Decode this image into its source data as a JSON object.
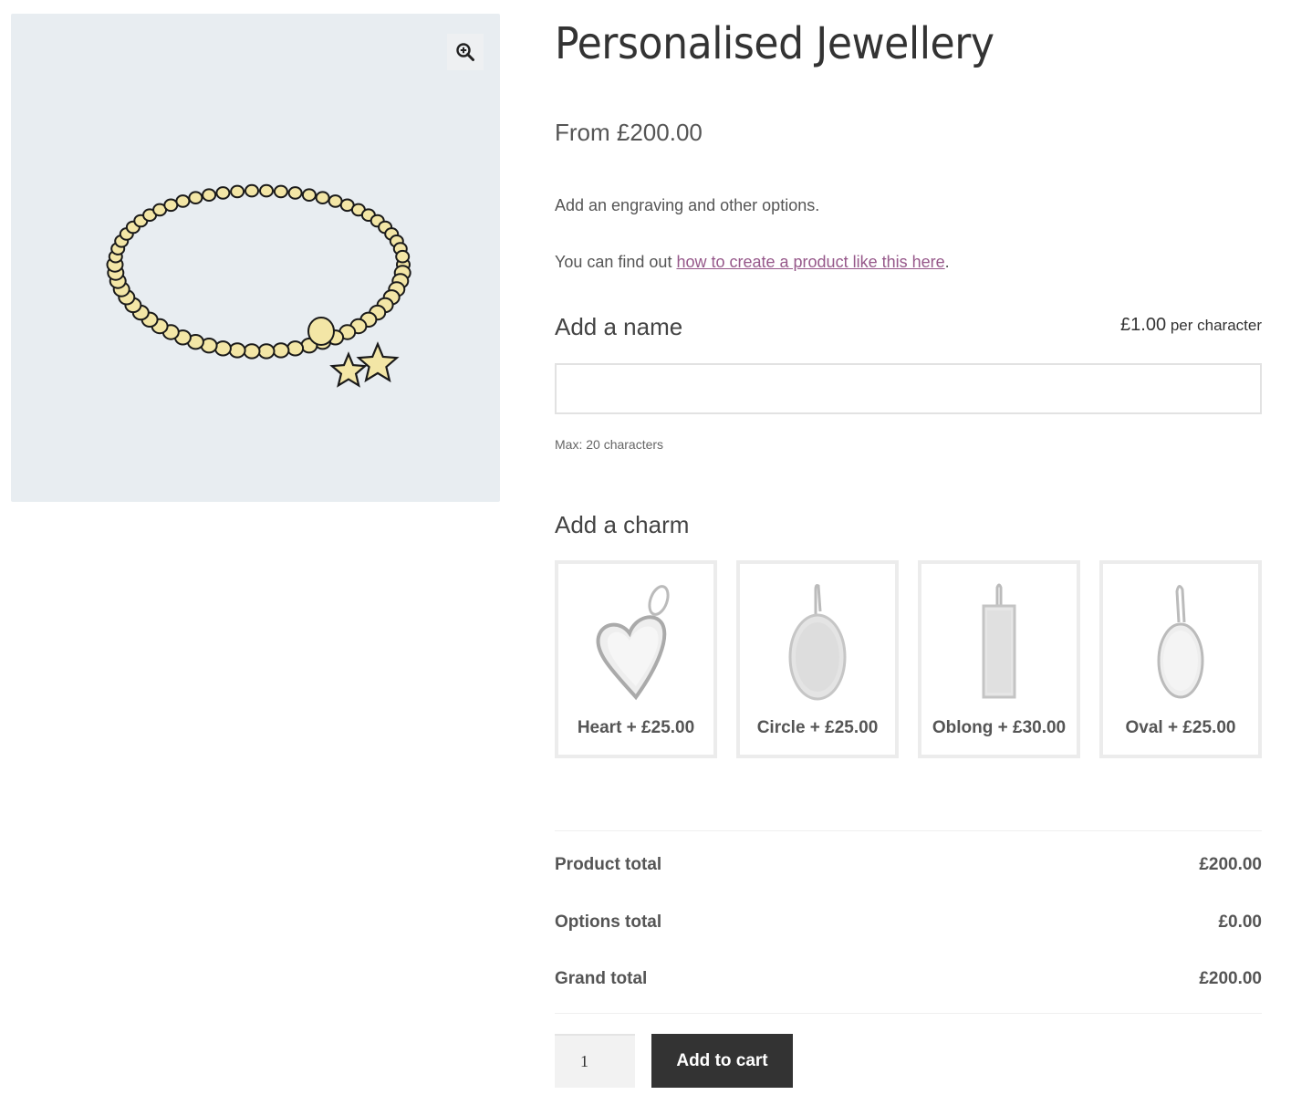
{
  "gallery": {
    "image_alt": "Gold beaded bracelet with two star charms",
    "zoom_icon": "magnifier-plus-icon"
  },
  "product": {
    "title": "Personalised Jewellery",
    "price": "From £200.00",
    "description": "Add an engraving and other options.",
    "info_prefix": "You can find out ",
    "info_link": "how to create a product like this here",
    "info_suffix": "."
  },
  "name_field": {
    "label": "Add a name",
    "price_amount": "£1.00",
    "price_unit": "per character",
    "value": "",
    "placeholder": "",
    "max_note": "Max: 20 characters"
  },
  "charm_field": {
    "label": "Add a charm",
    "options": [
      {
        "name": "Heart",
        "label": "Heart + £25.00",
        "shape": "heart"
      },
      {
        "name": "Circle",
        "label": "Circle + £25.00",
        "shape": "circle"
      },
      {
        "name": "Oblong",
        "label": "Oblong + £30.00",
        "shape": "oblong"
      },
      {
        "name": "Oval",
        "label": "Oval + £25.00",
        "shape": "oval"
      }
    ]
  },
  "totals": {
    "rows": [
      {
        "label": "Product total",
        "value": "£200.00"
      },
      {
        "label": "Options total",
        "value": "£0.00"
      },
      {
        "label": "Grand total",
        "value": "£200.00"
      }
    ]
  },
  "cart": {
    "quantity": "1",
    "add_label": "Add to cart"
  },
  "colors": {
    "link": "#96588a",
    "button_bg": "#333333",
    "gallery_bg": "#e8edf1"
  }
}
